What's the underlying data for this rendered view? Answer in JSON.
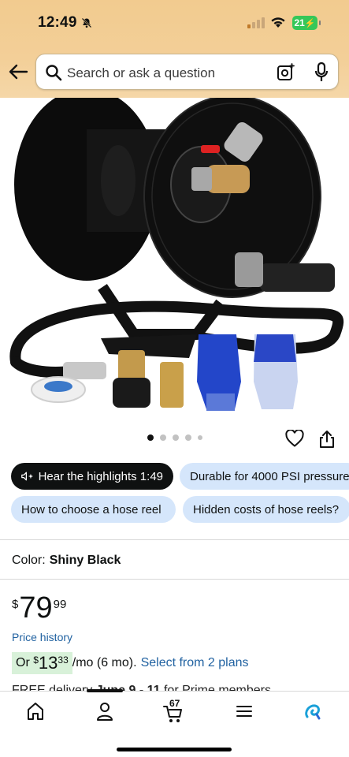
{
  "status_bar": {
    "time": "12:49",
    "battery": "21"
  },
  "search": {
    "placeholder": "Search or ask a question"
  },
  "carousel": {
    "total_dots": 5,
    "active_dot": 0
  },
  "chips": {
    "hear_highlights": "Hear the highlights 1:49",
    "durable": "Durable for 4000 PSI pressure",
    "how_to_choose": "How to choose a hose reel",
    "hidden_costs": "Hidden costs of hose reels?"
  },
  "color": {
    "label": "Color:",
    "value": "Shiny Black"
  },
  "price": {
    "currency": "$",
    "whole": "79",
    "fraction": "99"
  },
  "price_history_label": "Price history",
  "monthly": {
    "prefix": "Or",
    "currency": "$",
    "whole": "13",
    "fraction": "33",
    "term": "/mo (6 mo).",
    "plans_link": "Select from 2 plans"
  },
  "delivery": {
    "prefix": "FREE delivery",
    "dates": "June 9 - 11",
    "suffix": "for Prime members"
  },
  "bottom_nav": {
    "cart_count": "67"
  },
  "colors": {
    "header": "#f2cb8f",
    "chip_bg": "#d5e6fb",
    "link": "#2162a1",
    "battery": "#35c759"
  }
}
